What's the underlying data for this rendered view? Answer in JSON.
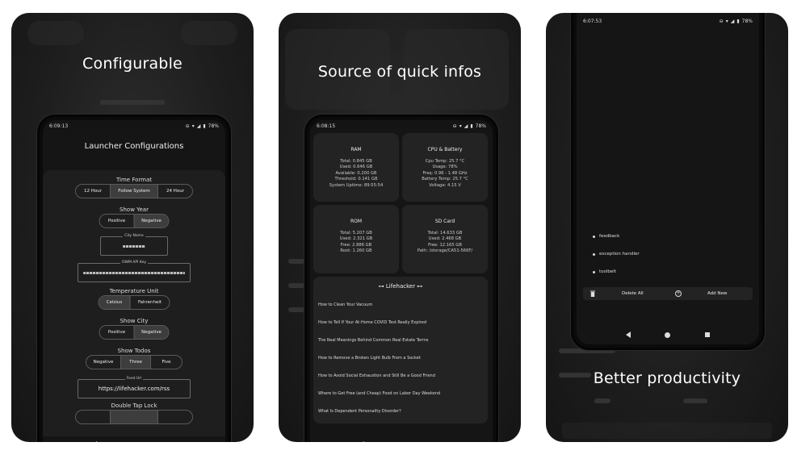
{
  "card1": {
    "headline": "Configurable",
    "status_time": "6:09:13",
    "battery": "78%",
    "screen_title": "Launcher Configurations",
    "time_format": {
      "label": "Time Format",
      "options": [
        "12 Hour",
        "Follow System",
        "24 Hour"
      ],
      "selected": "Follow System"
    },
    "show_year": {
      "label": "Show Year",
      "options": [
        "Positive",
        "Negative"
      ],
      "selected": "Negative"
    },
    "city_name": {
      "label": "City Name"
    },
    "owm_api_key": {
      "label": "OWM API Key"
    },
    "temperature_unit": {
      "label": "Temperature Unit",
      "options": [
        "Celsius",
        "Fahrenheit"
      ],
      "selected": "Celsius"
    },
    "show_city": {
      "label": "Show City",
      "options": [
        "Positive",
        "Negative"
      ],
      "selected": "Negative"
    },
    "show_todos": {
      "label": "Show Todos",
      "options": [
        "Negative",
        "Three",
        "Five"
      ],
      "selected": "Three"
    },
    "feed_url": {
      "label": "Feed Url",
      "value": "https://lifehacker.com/rss"
    },
    "double_tap_lock": {
      "label": "Double Tap Lock"
    }
  },
  "card2": {
    "headline": "Source of quick infos",
    "status_time": "6:08:15",
    "battery": "78%",
    "ram": {
      "title": "RAM",
      "lines": [
        "Total: 0.845 GB",
        "Used: 0.646 GB",
        "Available: 0.200 GB",
        "Threshold: 0.141 GB",
        "System Uptime: 89:55:54"
      ]
    },
    "cpu": {
      "title": "CPU & Battery",
      "lines": [
        "Cpu Temp: 25.7 °C",
        "Usage: 78%",
        "Freq: 0.96 - 1.48 GHz",
        "Battery Temp: 25.7 °C",
        "Voltage: 4.15 V"
      ]
    },
    "rom": {
      "title": "ROM",
      "lines": [
        "Total: 5.207 GB",
        "Used: 2.321 GB",
        "Free: 2.886 GB",
        "Root: 1.260 GB"
      ]
    },
    "sd": {
      "title": "SD Card",
      "lines": [
        "Total: 14.633 GB",
        "Used: 2.468 GB",
        "Free: 12.165 GB",
        "Path: /storage/CA51-566F/"
      ]
    },
    "news": {
      "title": "⊶ Lifehacker ⊷",
      "items": [
        "How to Clean Your Vacuum",
        "How to Tell If Your At-Home COVID Test Really Expired",
        "The Real Meanings Behind Common Real Estate Terms",
        "How to Remove a Broken Light Bulb From a Socket",
        "How to Avoid Social Exhaustion and Still Be a Good Friend",
        "Where to Get Free (and Cheap) Food on Labor Day Weekend",
        "What Is Dependent Personality Disorder?"
      ]
    }
  },
  "card3": {
    "headline": "Better productivity",
    "status_time": "6:07:53",
    "battery": "78%",
    "todos": [
      "feedback",
      "exception handler",
      "toolbelt"
    ],
    "delete_all": "Delete All",
    "add_new": "Add New"
  }
}
